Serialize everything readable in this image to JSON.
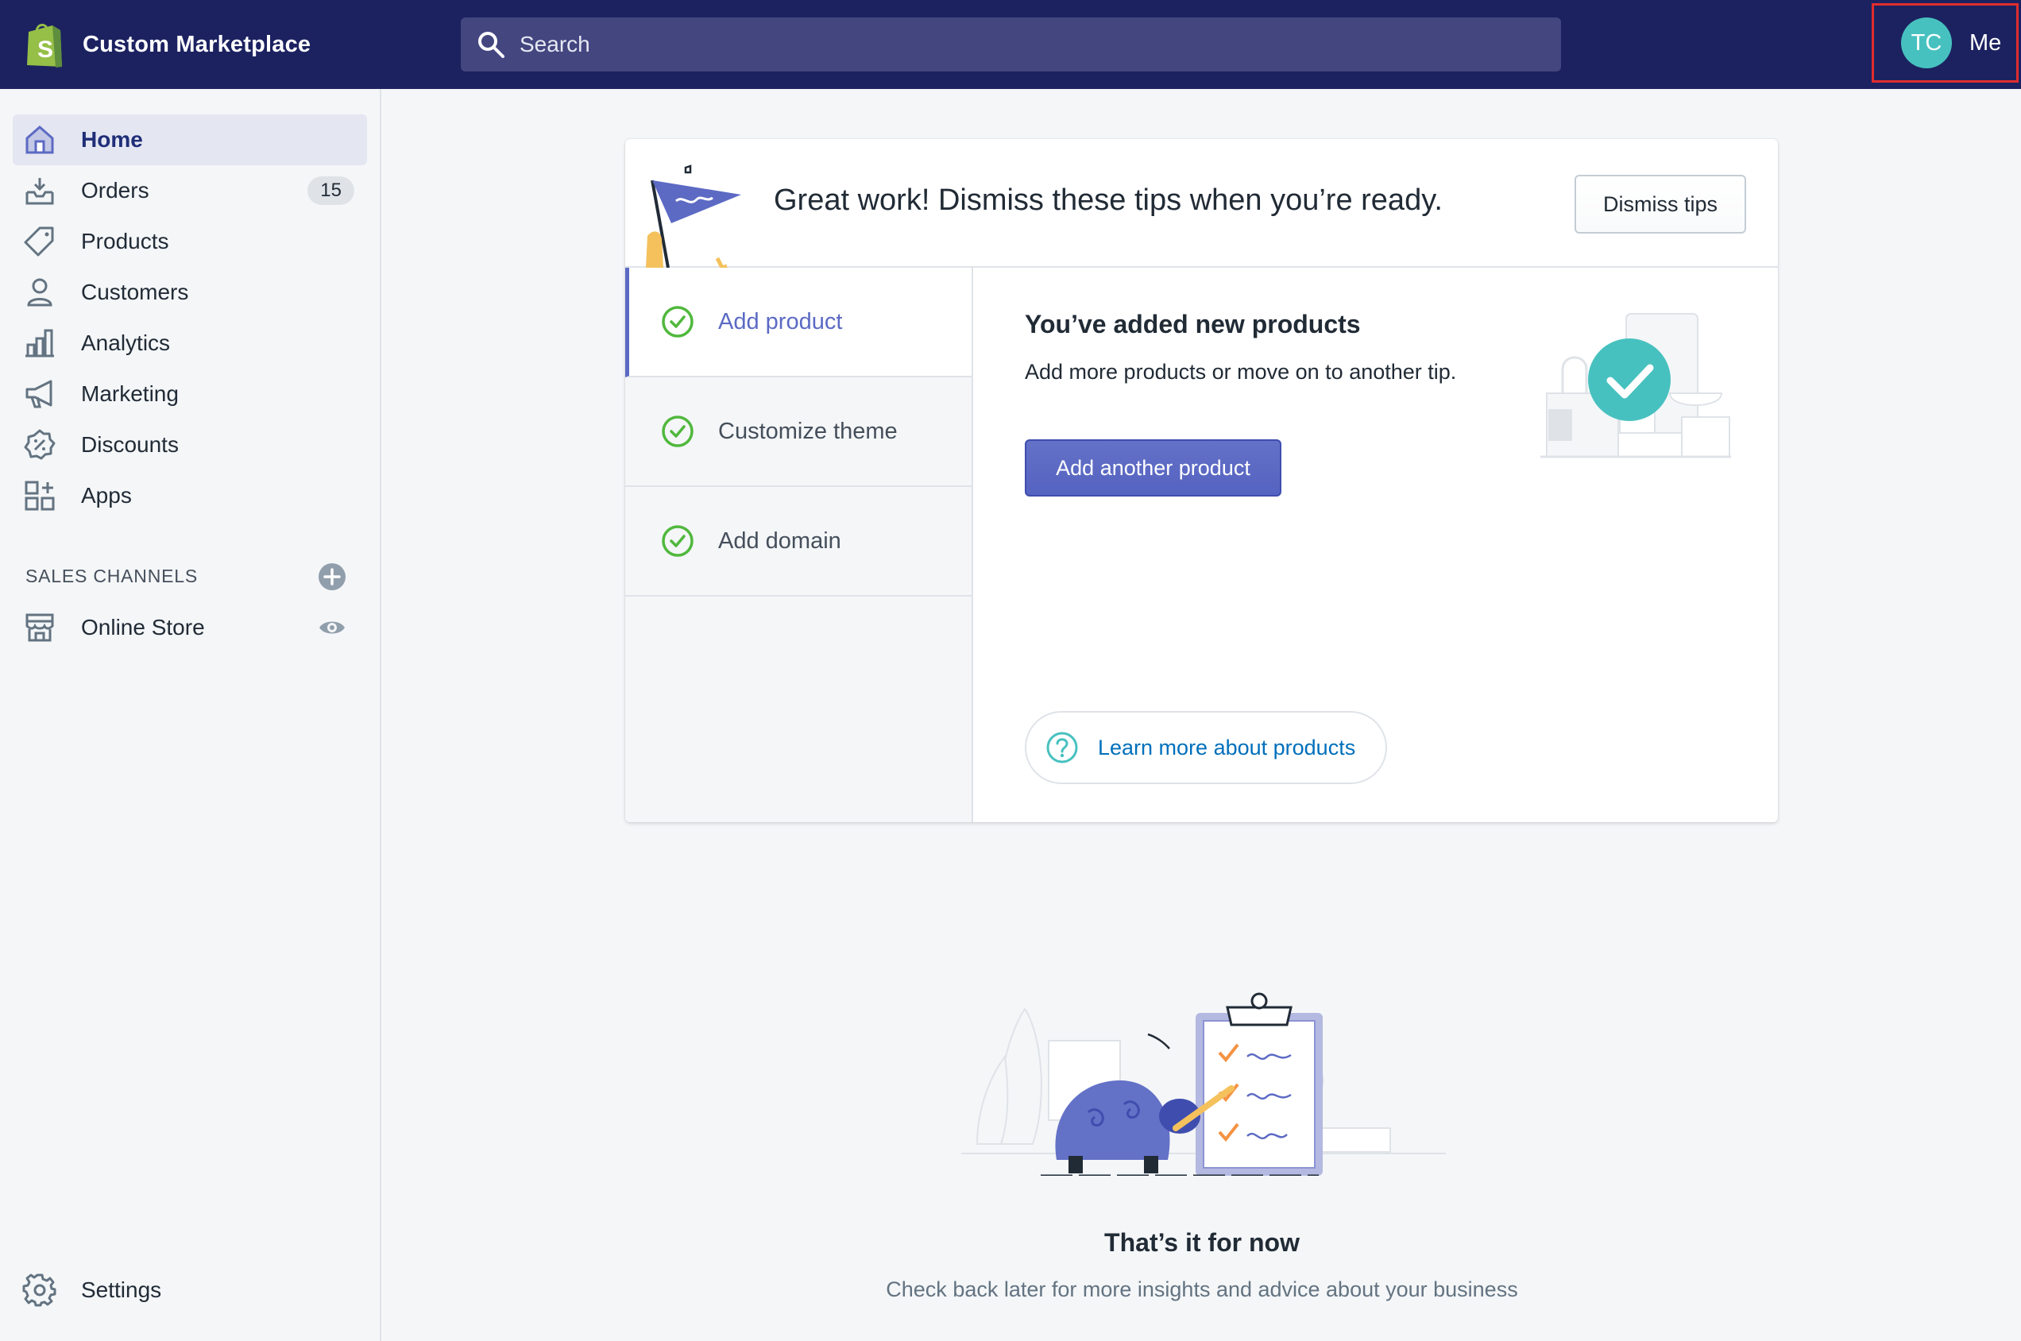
{
  "topbar": {
    "store_name": "Custom Marketplace",
    "search_placeholder": "Search",
    "avatar_initials": "TC",
    "me_label": "Me"
  },
  "sidebar": {
    "items": [
      {
        "label": "Home",
        "icon": "home-icon"
      },
      {
        "label": "Orders",
        "icon": "orders-icon",
        "badge": "15"
      },
      {
        "label": "Products",
        "icon": "tag-icon"
      },
      {
        "label": "Customers",
        "icon": "person-icon"
      },
      {
        "label": "Analytics",
        "icon": "bar-chart-icon"
      },
      {
        "label": "Marketing",
        "icon": "megaphone-icon"
      },
      {
        "label": "Discounts",
        "icon": "discount-icon"
      },
      {
        "label": "Apps",
        "icon": "apps-icon"
      }
    ],
    "sales_channels_title": "SALES CHANNELS",
    "online_store_label": "Online Store",
    "settings_label": "Settings"
  },
  "tips": {
    "title": "Great work! Dismiss these tips when you’re ready.",
    "dismiss_label": "Dismiss tips",
    "tabs": [
      {
        "label": "Add product"
      },
      {
        "label": "Customize theme"
      },
      {
        "label": "Add domain"
      }
    ],
    "active_tip": {
      "title": "You’ve added new products",
      "body": "Add more products or move on to another tip.",
      "button_label": "Add another product",
      "learn_more_label": "Learn more about products"
    }
  },
  "empty_state": {
    "title": "That’s it for now",
    "text": "Check back later for more insights and advice about your business"
  },
  "colors": {
    "topbar_bg": "#1c2260",
    "accent": "#5c6ac4",
    "success": "#50b83c",
    "avatar": "#47c1bf",
    "link": "#006fbb"
  }
}
